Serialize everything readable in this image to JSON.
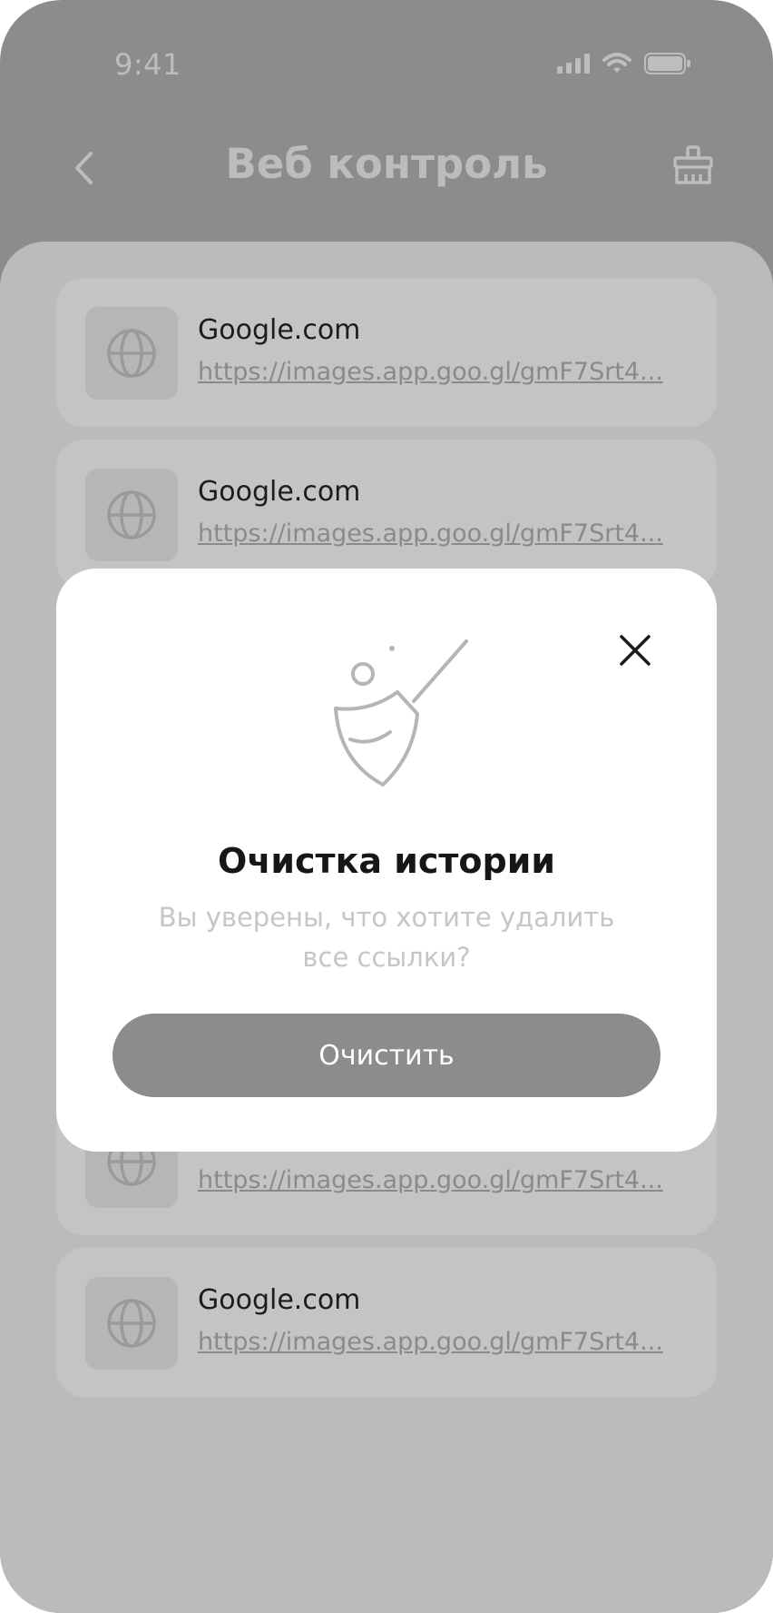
{
  "status_bar": {
    "time": "9:41",
    "icons": [
      "signal-icon",
      "wifi-icon",
      "battery-icon"
    ]
  },
  "header": {
    "title": "Веб контроль",
    "back_icon": "chevron-left-icon",
    "clear_icon": "broom-icon"
  },
  "list": {
    "items": [
      {
        "title": "Google.com",
        "url": "https://images.app.goo.gl/gmF7Srt4..."
      },
      {
        "title": "Google.com",
        "url": "https://images.app.goo.gl/gmF7Srt4..."
      },
      {
        "title": "",
        "url": "https://images.app.goo.gl/gmF7Srt4..."
      },
      {
        "title": "Google.com",
        "url": "https://images.app.goo.gl/gmF7Srt4..."
      }
    ]
  },
  "modal": {
    "title": "Очистка истории",
    "text": "Вы уверены, что хотите удалить все ссылки?",
    "button_label": "Очистить",
    "illustration_icon": "broom-icon",
    "close_icon": "close-icon"
  },
  "colors": {
    "background": "#8c8c8c",
    "sheet": "#bbbbbb",
    "card": "#c4c4c4",
    "modal": "#ffffff",
    "button": "#8c8c8c"
  }
}
